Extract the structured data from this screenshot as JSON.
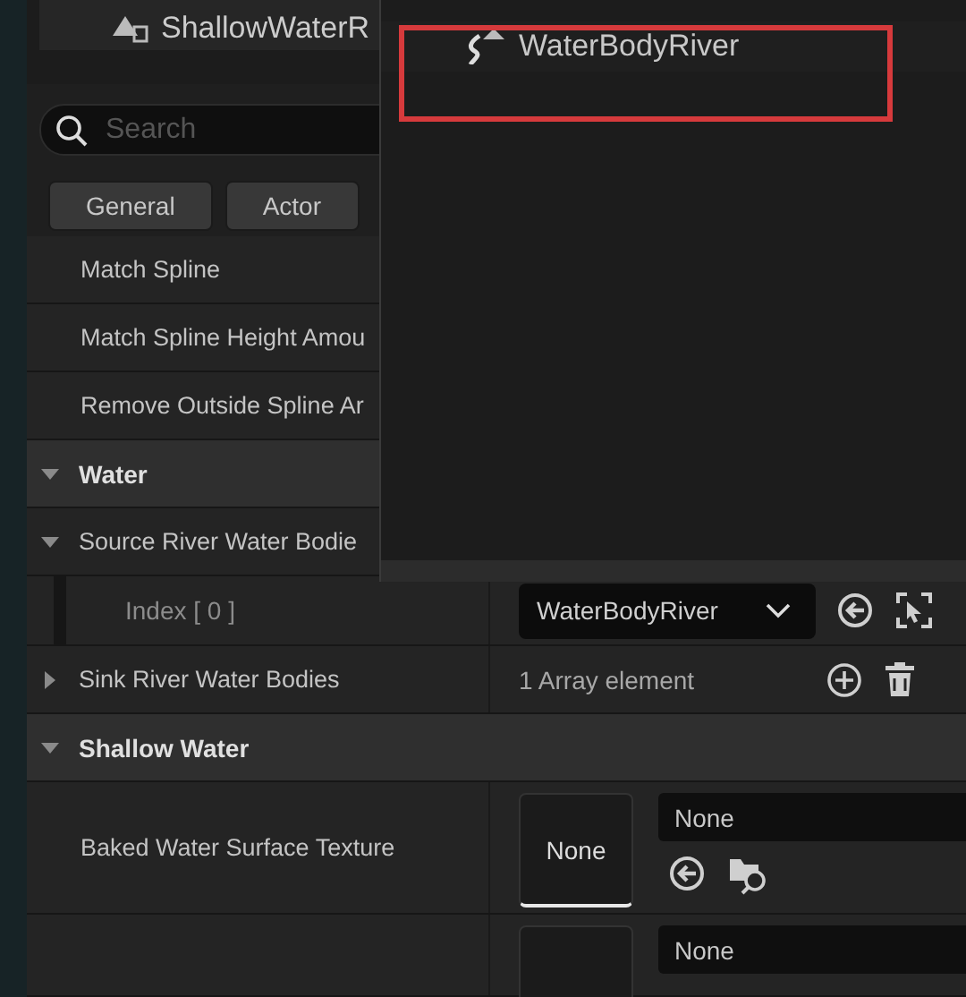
{
  "outliner": {
    "item": "ShallowWaterR"
  },
  "search": {
    "placeholder": "Search"
  },
  "filters": [
    {
      "label": "General"
    },
    {
      "label": "Actor"
    }
  ],
  "rows": [
    {
      "kind": "property",
      "name": "Match Spline"
    },
    {
      "kind": "property",
      "name": "Match Spline Height Amou"
    },
    {
      "kind": "property",
      "name": "Remove Outside Spline Ar"
    },
    {
      "kind": "category",
      "name": "Water",
      "expanded": true
    },
    {
      "kind": "array",
      "name": "Source River Water Bodie",
      "expanded": true
    },
    {
      "kind": "element",
      "name": "Index [ 0 ]",
      "value": "WaterBodyRiver"
    },
    {
      "kind": "array",
      "name": "Sink River Water Bodies",
      "expanded": false,
      "value": "1 Array element"
    },
    {
      "kind": "category",
      "name": "Shallow Water",
      "expanded": true
    },
    {
      "kind": "texture",
      "name": "Baked Water Surface Texture",
      "thumbnail": "None",
      "value": "None"
    },
    {
      "kind": "texture",
      "value": "None"
    }
  ],
  "popup": {
    "items": [
      {
        "label": "WaterBodyRiver",
        "highlighted": true
      }
    ]
  }
}
